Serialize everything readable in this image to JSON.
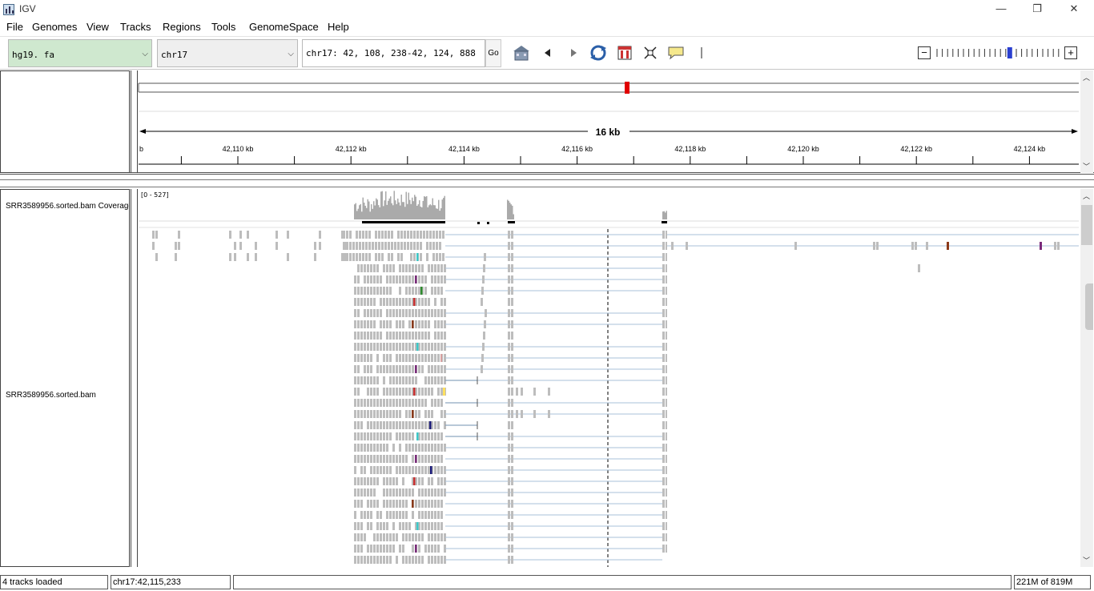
{
  "window": {
    "title": "IGV",
    "minimize": "—",
    "restore": "❐",
    "close": "✕"
  },
  "menu": [
    "File",
    "Genomes",
    "View",
    "Tracks",
    "Regions",
    "Tools",
    "GenomeSpace",
    "Help"
  ],
  "toolbar": {
    "genome": "hg19. fa",
    "chromosome": "chr17",
    "locus": "chr17: 42, 108, 238-42, 124, 888",
    "go_label": "Go",
    "zoom_minus": "−",
    "zoom_plus": "+",
    "zoom_level_fraction": 0.58
  },
  "ruler": {
    "span_label": "16 kb",
    "tick_labels": [
      "42,110 kb",
      "42,112 kb",
      "42,114 kb",
      "42,116 kb",
      "42,118 kb",
      "42,120 kb",
      "42,122 kb",
      "42,124 kb"
    ],
    "left_clip_label": "b"
  },
  "tracks": {
    "coverage_name": "SRR3589956.sorted.bam Coverage",
    "coverage_range": "[0 - 527]",
    "bam_name": "SRR3589956.sorted.bam"
  },
  "status": {
    "tracks_loaded": "4 tracks loaded",
    "position": "chr17:42,115,233",
    "message": "",
    "memory": "221M of 819M"
  },
  "colors": {
    "highlight_genome": "#cfe8cf",
    "chrom_marker": "#e00000",
    "read": "#bdbdbd",
    "coverage": "#aaaaaa",
    "zoom_marker": "#2a3fd0"
  }
}
